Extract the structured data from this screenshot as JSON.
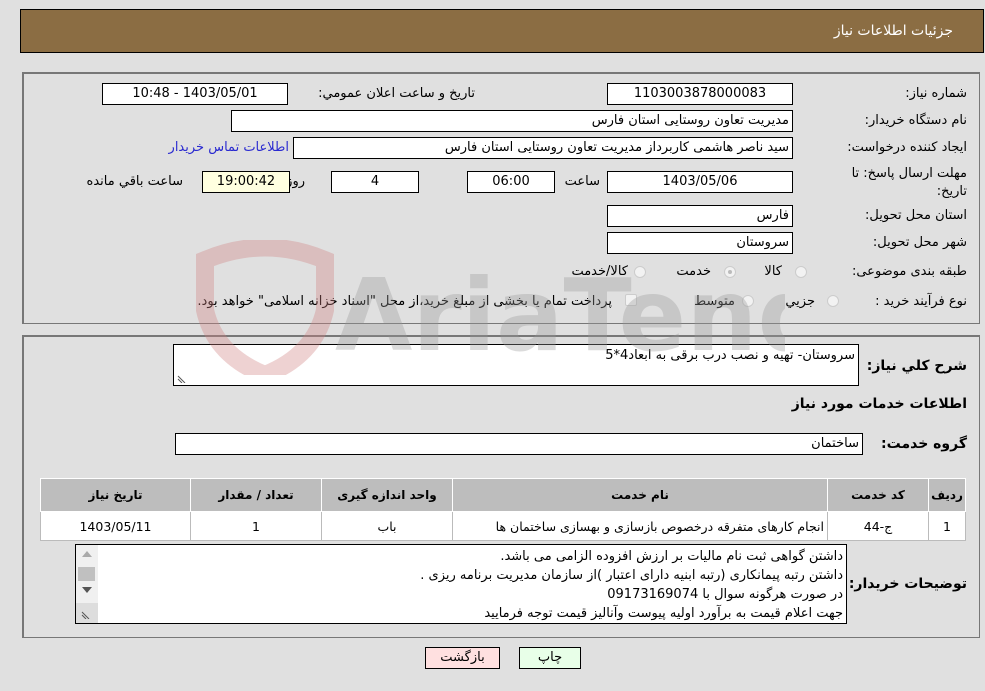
{
  "header": {
    "title": "جزئیات اطلاعات نیاز"
  },
  "form": {
    "need_number_label": "شماره نیاز:",
    "need_number": "1103003878000083",
    "announce_label": "تاریخ و ساعت اعلان عمومي:",
    "announce_value": "1403/05/01 - 10:48",
    "buyer_org_label": "نام دستگاه خریدار:",
    "buyer_org": "مدیریت تعاون روستایی استان فارس",
    "creator_label": "ایجاد کننده درخواست:",
    "creator": "سید ناصر هاشمی کاربرداز مدیریت تعاون روستایی استان فارس",
    "contact_link": "اطلاعات تماس خریدار",
    "deadline_label_1": "مهلت ارسال پاسخ: تا",
    "deadline_label_2": "تاریخ:",
    "deadline_date": "1403/05/06",
    "time_label": "ساعت",
    "deadline_time": "06:00",
    "days_value": "4",
    "days_label": "روز و",
    "remaining_time": "19:00:42",
    "remaining_label": "ساعت باقي مانده",
    "province_label": "استان محل تحویل:",
    "province": "فارس",
    "city_label": "شهر محل تحویل:",
    "city": "سروستان",
    "category_label": "طبقه بندی موضوعی:",
    "category_options": [
      "کالا",
      "خدمت",
      "کالا/خدمت"
    ],
    "category_selected": "خدمت",
    "process_label": "نوع فرآیند خرید :",
    "process_options": [
      "جزيي",
      "متوسط"
    ],
    "treasury_note": "پرداخت تمام یا بخشی از مبلغ خرید،از محل \"اسناد خزانه اسلامی\" خواهد بود."
  },
  "details": {
    "summary_label": "شرح كلي نياز:",
    "summary": "سروستان- تهیه و نصب درب برقی به ابعاد4*5",
    "services_heading": "اطلاعات خدمات مورد نیاز",
    "service_group_label": "گروه خدمت:",
    "service_group": "ساختمان",
    "table": {
      "headers": [
        "ردیف",
        "کد خدمت",
        "نام خدمت",
        "واحد اندازه گیری",
        "تعداد / مقدار",
        "تاریخ نیاز"
      ],
      "rows": [
        [
          "1",
          "ج-44",
          "انجام کارهای متفرقه درخصوص بازسازی و بهسازی ساختمان ها",
          "باب",
          "1",
          "1403/05/11"
        ]
      ]
    },
    "buyer_notes_label": "توضیحات خریدار:",
    "buyer_notes": [
      "داشتن گواهی ثبت نام مالیات بر ارزش افزوده الزامی می باشد.",
      "داشتن رتبه پیمانکاری (رتبه ابنیه دارای اعتبار )از سازمان مدیریت برنامه ریزی .",
      "در صورت هرگونه سوال با 09173169074",
      "جهت اعلام قیمت به برآورد اولیه پیوست وآنالیز قیمت توجه فرمایید"
    ]
  },
  "buttons": {
    "back": "بازگشت",
    "print": "چاپ"
  },
  "watermark": {
    "text": "AriaTender.neT"
  }
}
